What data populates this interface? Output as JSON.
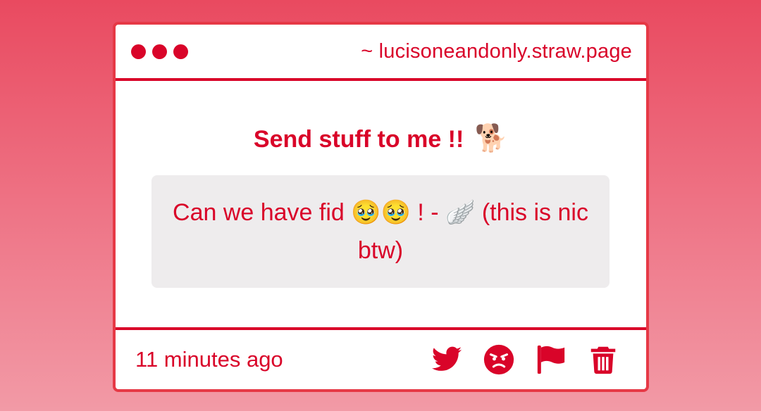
{
  "window": {
    "url": "~ lucisoneandonly.straw.page"
  },
  "page": {
    "heading": "Send stuff to me !!",
    "heading_emoji": "🐕",
    "message": "Can we have fid 🥹🥹 ! - 🪽 (this is nic btw)"
  },
  "footer": {
    "timestamp": "11 minutes ago",
    "actions": [
      "twitter-icon",
      "angry-face-icon",
      "flag-icon",
      "trash-icon"
    ]
  },
  "colors": {
    "accent": "#d90429",
    "card_border": "#e63946",
    "message_bg": "#eeeced",
    "background_top": "#e94a60",
    "background_bottom": "#f29aa6"
  }
}
